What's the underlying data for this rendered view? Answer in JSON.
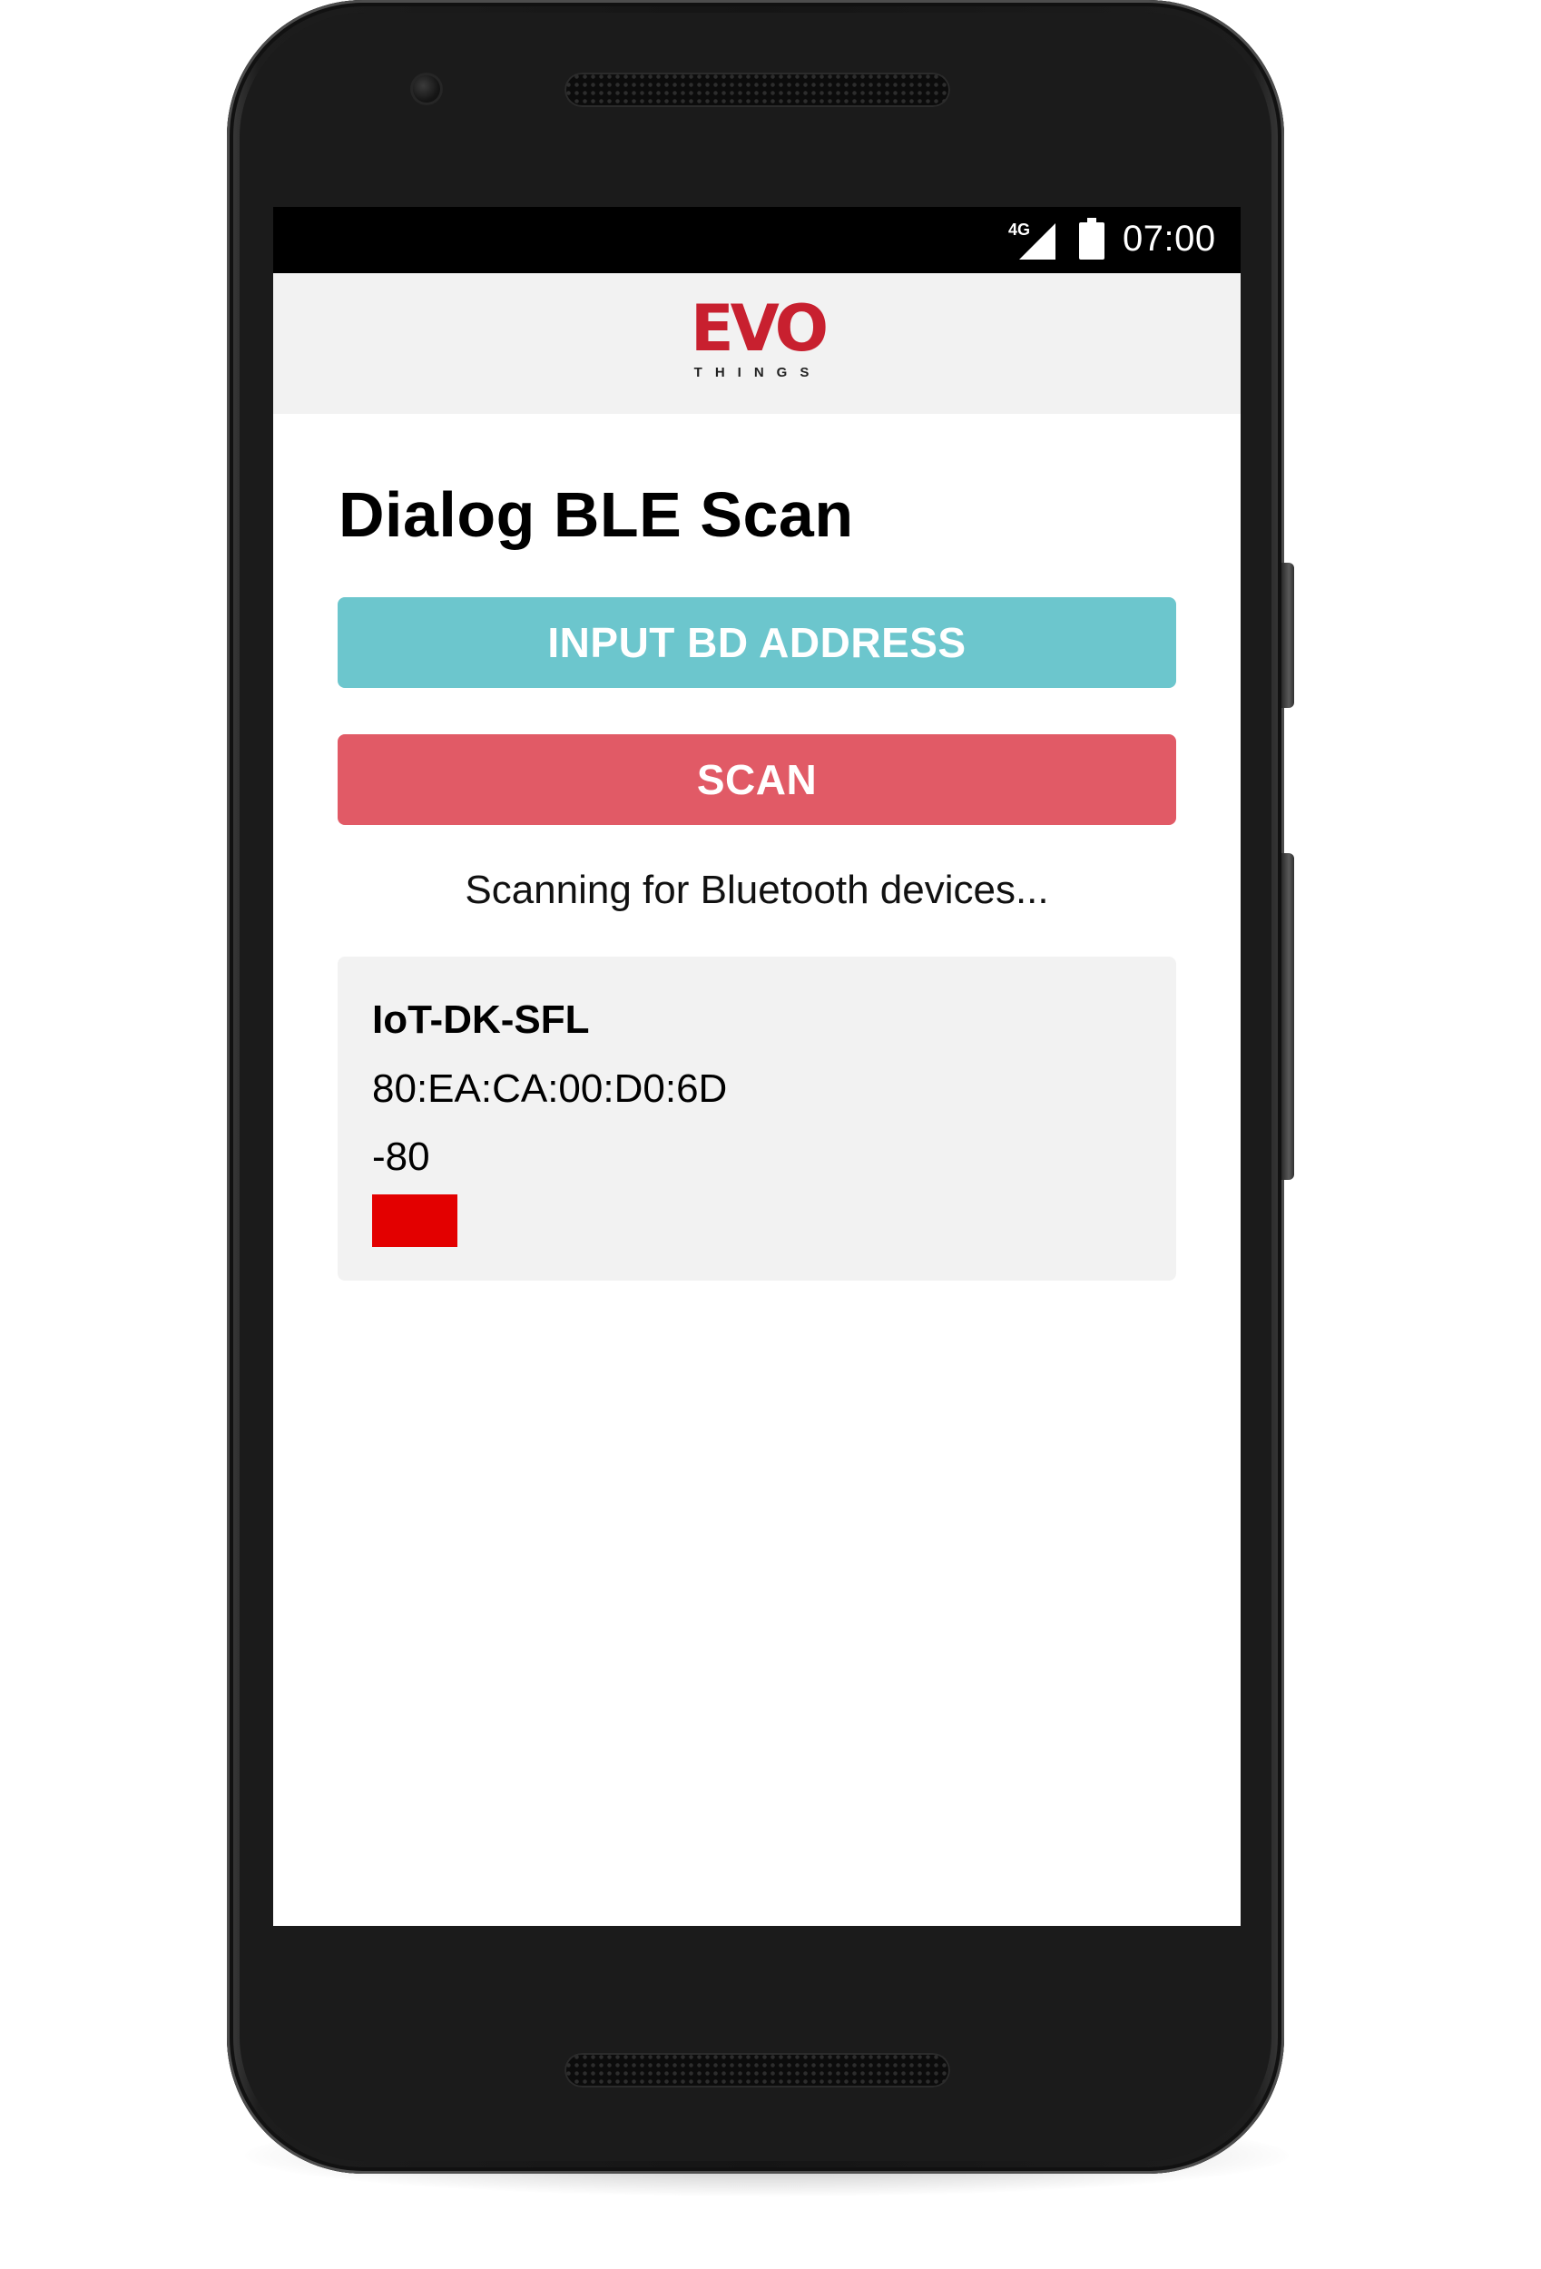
{
  "status_bar": {
    "network": "4G",
    "time": "07:00",
    "signal_icon": "cell-signal-icon",
    "battery_icon": "battery-full-icon"
  },
  "header": {
    "logo_text": "EVO",
    "logo_subtext": "THINGS",
    "logo_color": "#c8202f"
  },
  "page": {
    "title": "Dialog BLE Scan"
  },
  "buttons": {
    "input_bd_address": {
      "label": "INPUT BD ADDRESS",
      "color": "#6cc6cd"
    },
    "scan": {
      "label": "SCAN",
      "color": "#e15a66"
    }
  },
  "scan_status": "Scanning for Bluetooth devices...",
  "devices": [
    {
      "name": "IoT-DK-SFL",
      "address": "80:EA:CA:00:D0:6D",
      "rssi": "-80",
      "signal_level_fraction": 0.127,
      "signal_color": "#e30000"
    }
  ]
}
